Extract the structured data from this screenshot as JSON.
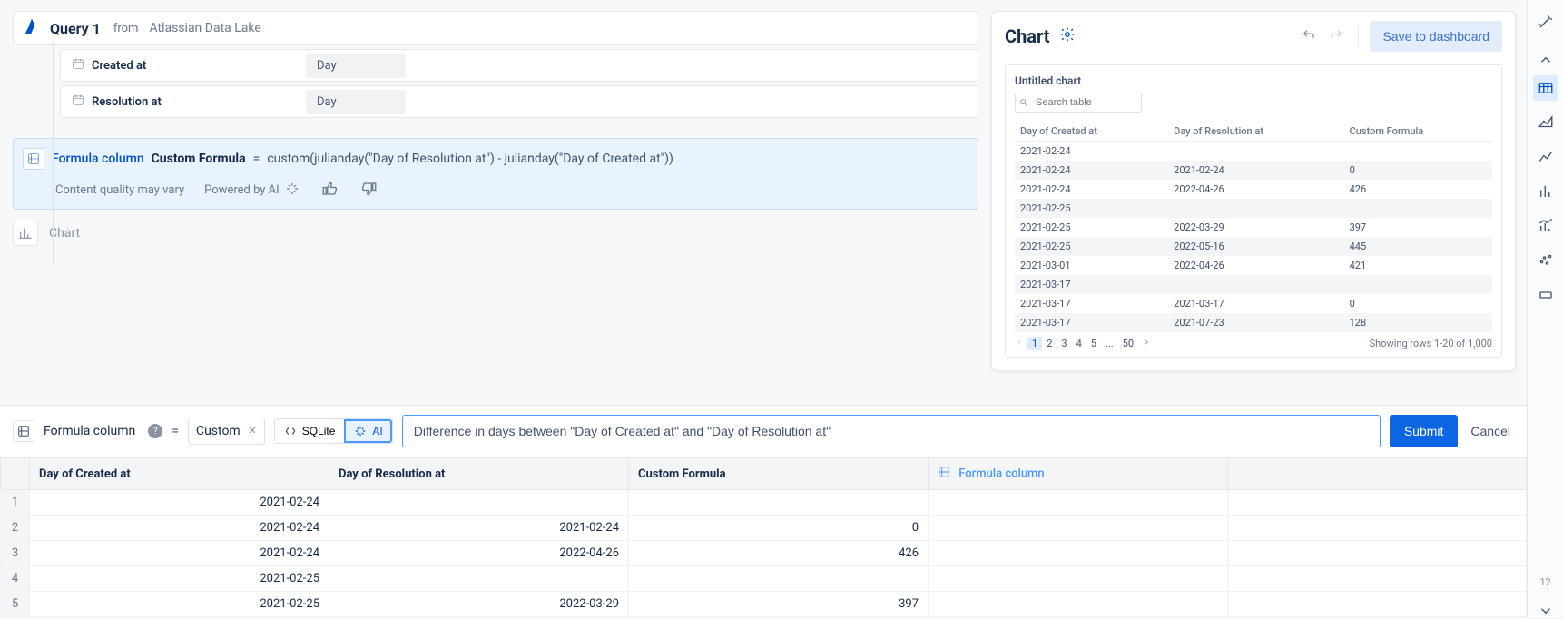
{
  "query": {
    "title": "Query 1",
    "from_label": "from",
    "source": "Atlassian Data Lake",
    "rows": [
      {
        "field": "Created at",
        "grain": "Day"
      },
      {
        "field": "Resolution at",
        "grain": "Day"
      }
    ]
  },
  "formula_card": {
    "link_label": "Formula column",
    "name": "Custom Formula",
    "eq": "=",
    "expr": "custom(julianday(\"Day of Resolution at\") - julianday(\"Day of Created at\"))",
    "disclaimer": "Content quality may vary",
    "powered": "Powered by AI"
  },
  "chart_placeholder": "Chart",
  "chart_panel": {
    "title": "Chart",
    "save_label": "Save to dashboard",
    "untitled": "Untitled chart",
    "search_placeholder": "Search table",
    "columns": [
      "Day of Created at",
      "Day of Resolution at",
      "Custom Formula"
    ],
    "rows": [
      {
        "c": "2021-02-24",
        "r": "",
        "f": ""
      },
      {
        "c": "2021-02-24",
        "r": "2021-02-24",
        "f": "0"
      },
      {
        "c": "2021-02-24",
        "r": "2022-04-26",
        "f": "426"
      },
      {
        "c": "2021-02-25",
        "r": "",
        "f": ""
      },
      {
        "c": "2021-02-25",
        "r": "2022-03-29",
        "f": "397"
      },
      {
        "c": "2021-02-25",
        "r": "2022-05-16",
        "f": "445"
      },
      {
        "c": "2021-03-01",
        "r": "2022-04-26",
        "f": "421"
      },
      {
        "c": "2021-03-17",
        "r": "",
        "f": ""
      },
      {
        "c": "2021-03-17",
        "r": "2021-03-17",
        "f": "0"
      },
      {
        "c": "2021-03-17",
        "r": "2021-07-23",
        "f": "128"
      }
    ],
    "pager": {
      "pages": [
        "1",
        "2",
        "3",
        "4",
        "5",
        "...",
        "50"
      ],
      "active": "1",
      "showing": "Showing rows 1-20 of 1,000"
    }
  },
  "right_rail": {
    "count": "12"
  },
  "formula_bar": {
    "label": "Formula column",
    "eq": "=",
    "chip": "Custom",
    "sqlite_label": "SQLite",
    "ai_label": "AI",
    "input_value": "Difference in days between \"Day of Created at\" and \"Day of Resolution at\"",
    "submit": "Submit",
    "cancel": "Cancel"
  },
  "data_table": {
    "headers": [
      "",
      "Day of Created at",
      "Day of Resolution at",
      "Custom Formula",
      "Formula column",
      ""
    ],
    "rows": [
      {
        "n": "1",
        "c": "2021-02-24",
        "r": "",
        "f": ""
      },
      {
        "n": "2",
        "c": "2021-02-24",
        "r": "2021-02-24",
        "f": "0"
      },
      {
        "n": "3",
        "c": "2021-02-24",
        "r": "2022-04-26",
        "f": "426"
      },
      {
        "n": "4",
        "c": "2021-02-25",
        "r": "",
        "f": ""
      },
      {
        "n": "5",
        "c": "2021-02-25",
        "r": "2022-03-29",
        "f": "397"
      }
    ]
  }
}
